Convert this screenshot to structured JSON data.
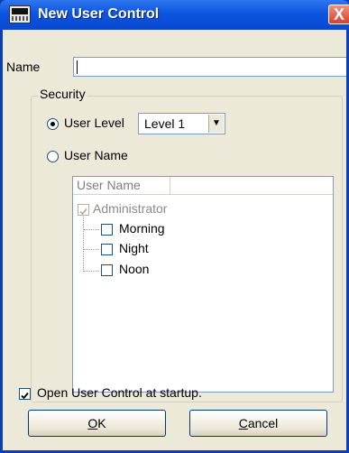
{
  "window": {
    "title": "New User Control",
    "close_label": "X"
  },
  "name_field": {
    "label": "Name",
    "value": ""
  },
  "security": {
    "group_label": "Security",
    "user_level": {
      "label": "User Level",
      "selected": true,
      "value": "Level 1"
    },
    "user_name": {
      "label": "User Name",
      "selected": false
    },
    "list": {
      "column_header": "User Name",
      "root": {
        "label": "Administrator",
        "checked": true,
        "disabled": true
      },
      "children": [
        {
          "label": "Morning",
          "checked": false
        },
        {
          "label": "Night",
          "checked": false
        },
        {
          "label": "Noon",
          "checked": false
        }
      ]
    }
  },
  "startup": {
    "label": "Open User Control at startup.",
    "checked": true
  },
  "buttons": {
    "ok_prefix": "O",
    "ok_rest": "K",
    "cancel_prefix": "C",
    "cancel_rest": "ancel"
  },
  "colors": {
    "titlebar": "#0b55e0",
    "client": "#ece9d8",
    "close": "#d8402a"
  }
}
